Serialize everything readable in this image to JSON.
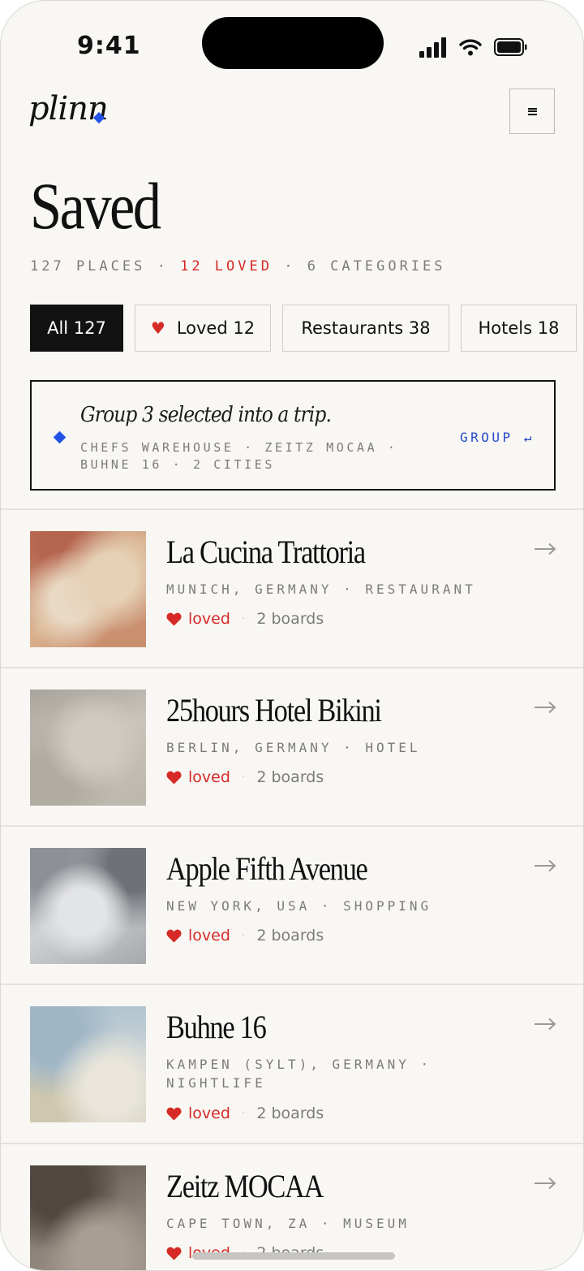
{
  "status_bar": {
    "time": "9:41"
  },
  "header": {
    "logo": "plinn",
    "menu_icon": "hamburger-icon"
  },
  "page": {
    "title": "Saved",
    "stats": {
      "places": "127 PLACES",
      "sep1": " · ",
      "loved": "12 LOVED",
      "sep2": " · ",
      "categories": "6 CATEGORIES"
    }
  },
  "filters": [
    {
      "label": "All 127",
      "active": true
    },
    {
      "label": "Loved 12",
      "icon": "heart-icon"
    },
    {
      "label": "Restaurants 38"
    },
    {
      "label": "Hotels 18"
    }
  ],
  "group_banner": {
    "title": "Group 3 selected into a trip.",
    "detail": "CHEFS WAREHOUSE · ZEITZ MOCAA · BUHNE 16 · 2 CITIES",
    "action": "GROUP ↵"
  },
  "places": [
    {
      "name": "La Cucina Trattoria",
      "meta": "MUNICH, GERMANY · RESTAURANT",
      "loved": "loved",
      "boards": "2 boards"
    },
    {
      "name": "25hours Hotel Bikini",
      "meta": "BERLIN, GERMANY · HOTEL",
      "loved": "loved",
      "boards": "2 boards"
    },
    {
      "name": "Apple Fifth Avenue",
      "meta": "NEW YORK, USA · SHOPPING",
      "loved": "loved",
      "boards": "2 boards"
    },
    {
      "name": "Buhne 16",
      "meta": "KAMPEN (SYLT), GERMANY · NIGHTLIFE",
      "loved": "loved",
      "boards": "2 boards"
    },
    {
      "name": "Zeitz MOCAA",
      "meta": "CAPE TOWN, ZA · MUSEUM",
      "loved": "loved",
      "boards": "2 boards"
    }
  ],
  "colors": {
    "accent_blue": "#2352e8",
    "loved_red": "#d62a26",
    "background": "#f8f7f4",
    "ink": "#111111"
  }
}
